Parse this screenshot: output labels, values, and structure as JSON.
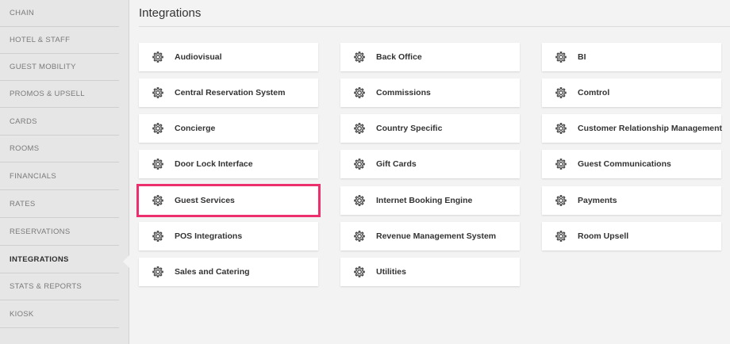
{
  "sidebar": {
    "items": [
      {
        "label": "CHAIN"
      },
      {
        "label": "HOTEL & STAFF"
      },
      {
        "label": "GUEST MOBILITY"
      },
      {
        "label": "PROMOS & UPSELL"
      },
      {
        "label": "CARDS"
      },
      {
        "label": "ROOMS"
      },
      {
        "label": "FINANCIALS"
      },
      {
        "label": "RATES"
      },
      {
        "label": "RESERVATIONS"
      },
      {
        "label": "INTEGRATIONS",
        "active": true
      },
      {
        "label": "STATS & REPORTS"
      },
      {
        "label": "KIOSK"
      }
    ]
  },
  "page": {
    "title": "Integrations"
  },
  "integrations": {
    "col1": [
      {
        "label": "Audiovisual",
        "icon": "gear-icon"
      },
      {
        "label": "Central Reservation System",
        "icon": "gear-icon"
      },
      {
        "label": "Concierge",
        "icon": "gear-icon"
      },
      {
        "label": "Door Lock Interface",
        "icon": "gear-icon"
      },
      {
        "label": "Guest Services",
        "icon": "gear-icon",
        "highlighted": true
      },
      {
        "label": "POS Integrations",
        "icon": "gear-icon"
      },
      {
        "label": "Sales and Catering",
        "icon": "gear-icon"
      }
    ],
    "col2": [
      {
        "label": "Back Office",
        "icon": "gear-icon"
      },
      {
        "label": "Commissions",
        "icon": "gear-icon"
      },
      {
        "label": "Country Specific",
        "icon": "gear-icon"
      },
      {
        "label": "Gift Cards",
        "icon": "gear-icon"
      },
      {
        "label": "Internet Booking Engine",
        "icon": "gear-icon"
      },
      {
        "label": "Revenue Management System",
        "icon": "gear-icon"
      },
      {
        "label": "Utilities",
        "icon": "gear-icon"
      }
    ],
    "col3": [
      {
        "label": "BI",
        "icon": "gear-icon"
      },
      {
        "label": "Comtrol",
        "icon": "gear-icon"
      },
      {
        "label": "Customer Relationship Management",
        "icon": "gear-icon"
      },
      {
        "label": "Guest Communications",
        "icon": "gear-icon"
      },
      {
        "label": "Payments",
        "icon": "gear-icon"
      },
      {
        "label": "Room Upsell",
        "icon": "gear-icon"
      }
    ]
  },
  "colors": {
    "highlight": "#ee2f6e"
  }
}
